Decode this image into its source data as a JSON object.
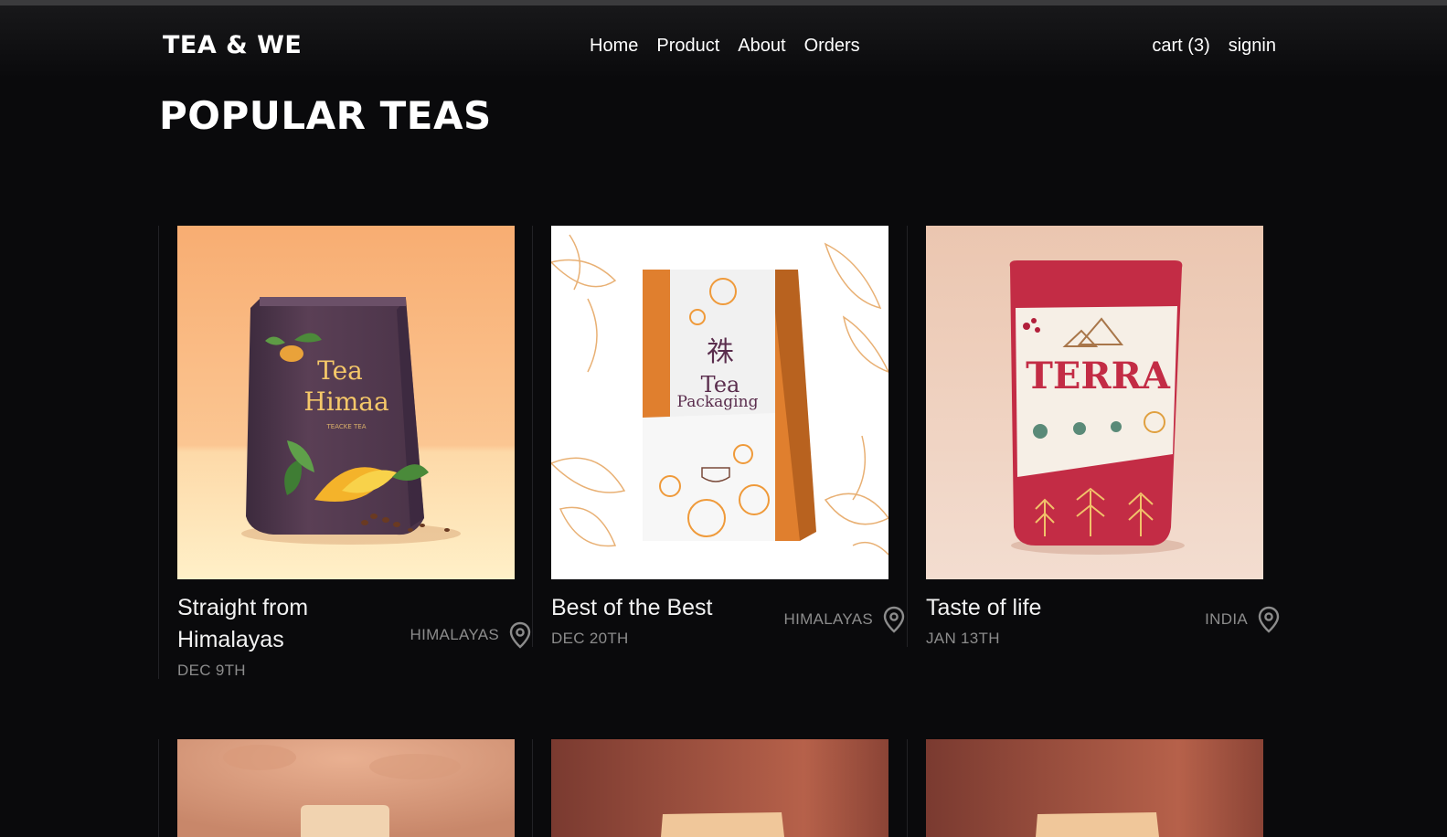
{
  "brand": "TEA & WE",
  "nav": {
    "links": [
      "Home",
      "Product",
      "About",
      "Orders"
    ],
    "cart": "cart (3)",
    "signin": "signin"
  },
  "page_title": "POPULAR TEAS",
  "products": [
    {
      "title": "Straight from Himalayas",
      "location": "HIMALAYAS",
      "date": "DEC 9TH",
      "image": "purple-tea-bag-himaa"
    },
    {
      "title": "Best of the Best",
      "location": "HIMALAYAS",
      "date": "DEC 20TH",
      "image": "orange-white-tea-packaging"
    },
    {
      "title": "Taste of life",
      "location": "INDIA",
      "date": "JAN 13TH",
      "image": "red-terra-pouch"
    }
  ],
  "product_bag_labels": [
    {
      "line1": "Tea",
      "line2": "Himaa",
      "sub": "TEACKE TEA"
    },
    {
      "glyph": "祩",
      "line1": "Tea",
      "line2": "Packaging"
    },
    {
      "line1": "TERRA"
    }
  ],
  "colors": {
    "background": "#0a0a0c",
    "muted_text": "#8c8c8c",
    "card1_bg": "#f6b37a",
    "card2_bg": "#ffffff",
    "card3_bg": "#efcdb8"
  }
}
